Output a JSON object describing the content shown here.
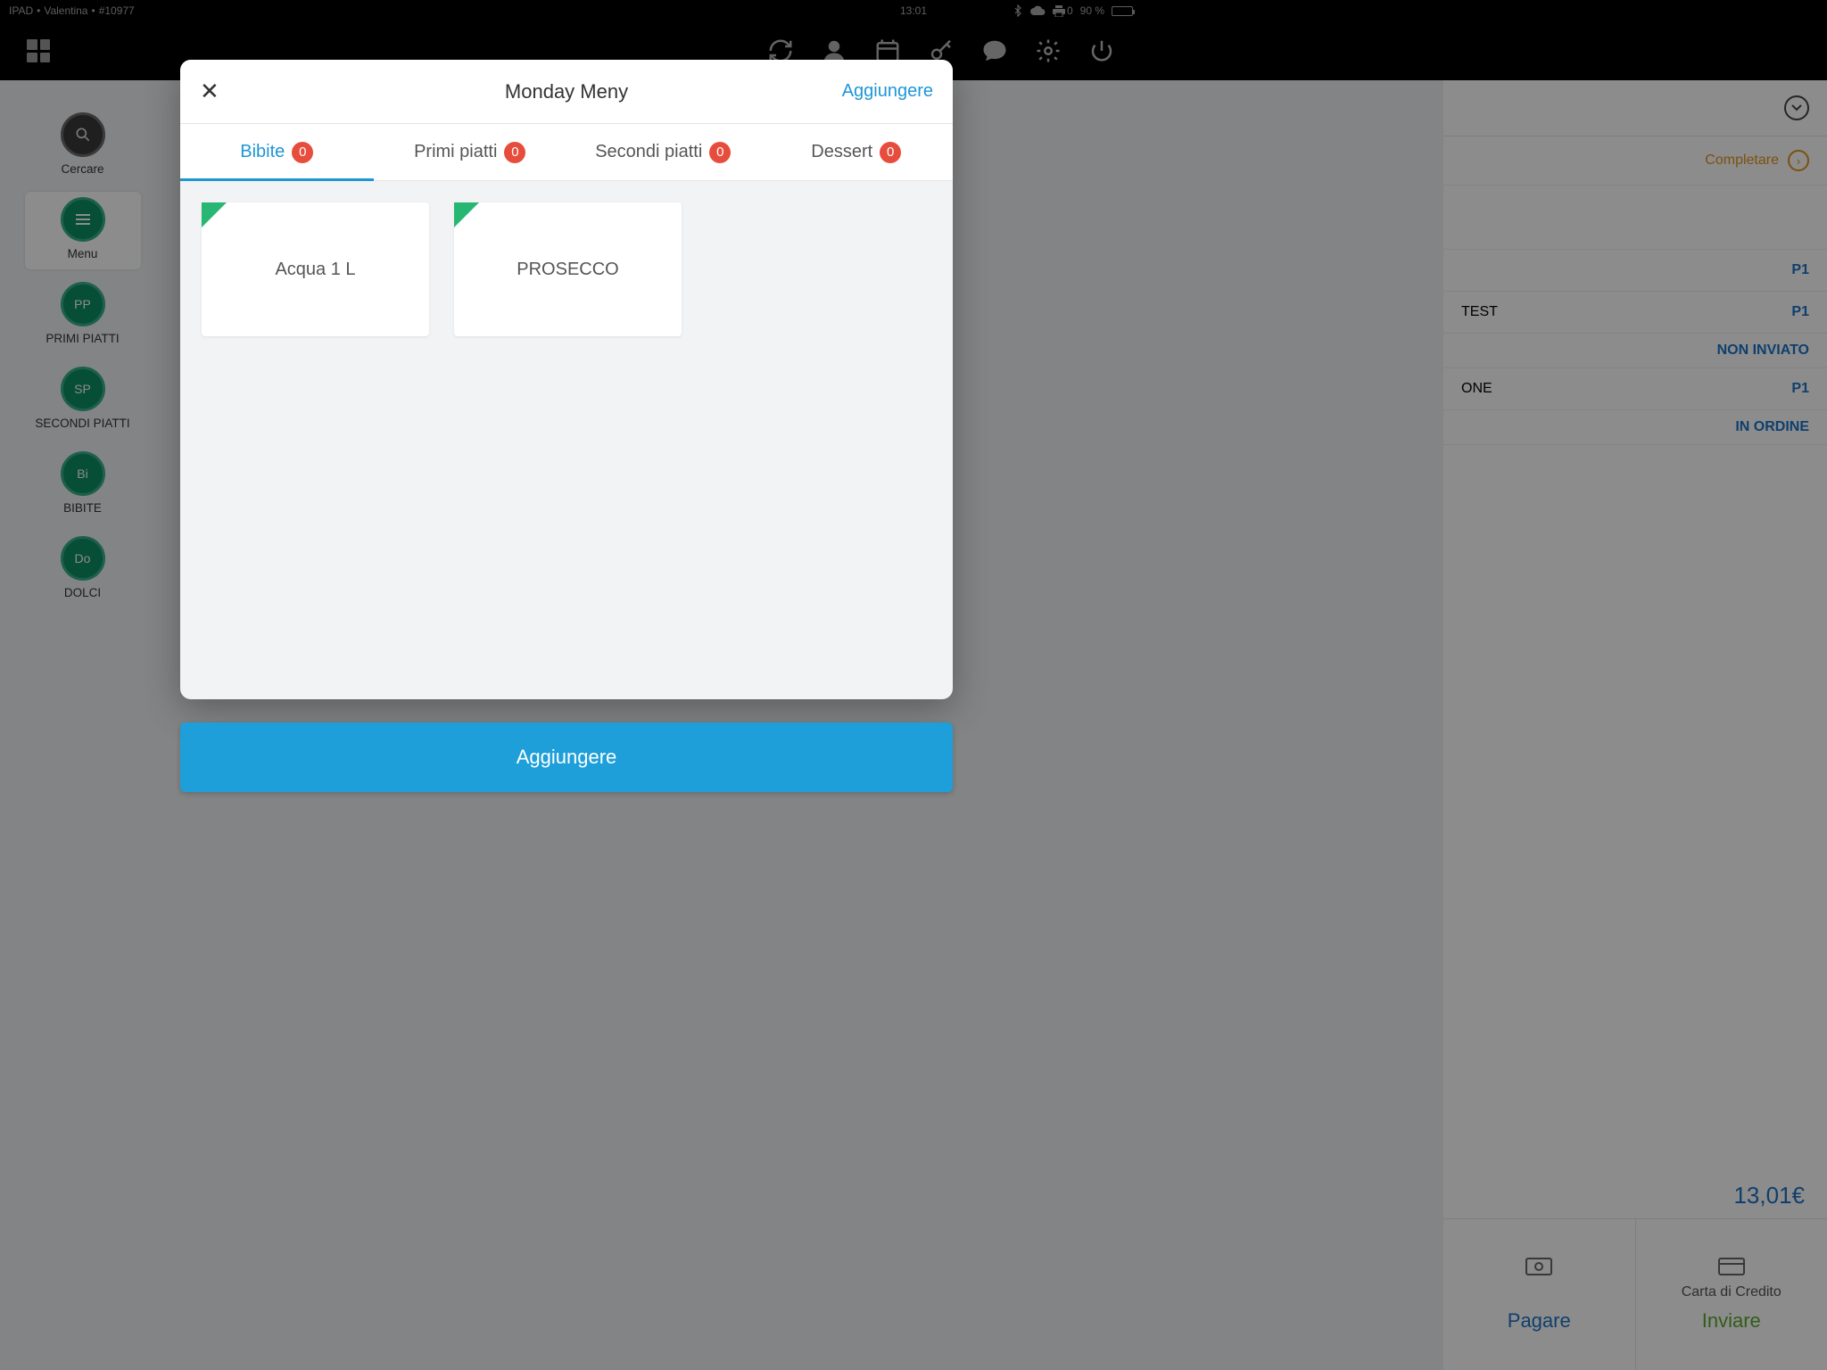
{
  "status": {
    "device": "IPAD",
    "user": "Valentina",
    "order_no": "#10977",
    "time": "13:01",
    "battery_count": "0",
    "battery_pct": "90 %"
  },
  "sidebar": {
    "items": [
      {
        "label": "Cercare",
        "abbr": ""
      },
      {
        "label": "Menu",
        "abbr": "≡"
      },
      {
        "label": "PRIMI PIATTI",
        "abbr": "PP"
      },
      {
        "label": "SECONDI PIATTI",
        "abbr": "SP"
      },
      {
        "label": "BIBITE",
        "abbr": "Bi"
      },
      {
        "label": "DOLCI",
        "abbr": "Do"
      }
    ]
  },
  "right": {
    "complete": "Completare",
    "rows": [
      {
        "text": "",
        "tag": "P1"
      },
      {
        "text": "TEST",
        "tag": "P1"
      }
    ],
    "status1": "NON INVIATO",
    "row3": {
      "text": "ONE",
      "tag": "P1"
    },
    "status2": "IN ORDINE",
    "total": "13,01€",
    "pay": {
      "label": "Pagare",
      "send": "Inviare",
      "card": "Carta di Credito"
    }
  },
  "modal": {
    "title": "Monday Meny",
    "add_link": "Aggiungere",
    "tabs": [
      {
        "label": "Bibite",
        "count": "0"
      },
      {
        "label": "Primi piatti",
        "count": "0"
      },
      {
        "label": "Secondi piatti",
        "count": "0"
      },
      {
        "label": "Dessert",
        "count": "0"
      }
    ],
    "items": [
      {
        "name": "Acqua 1 L"
      },
      {
        "name": "PROSECCO"
      }
    ],
    "add_button": "Aggiungere"
  }
}
